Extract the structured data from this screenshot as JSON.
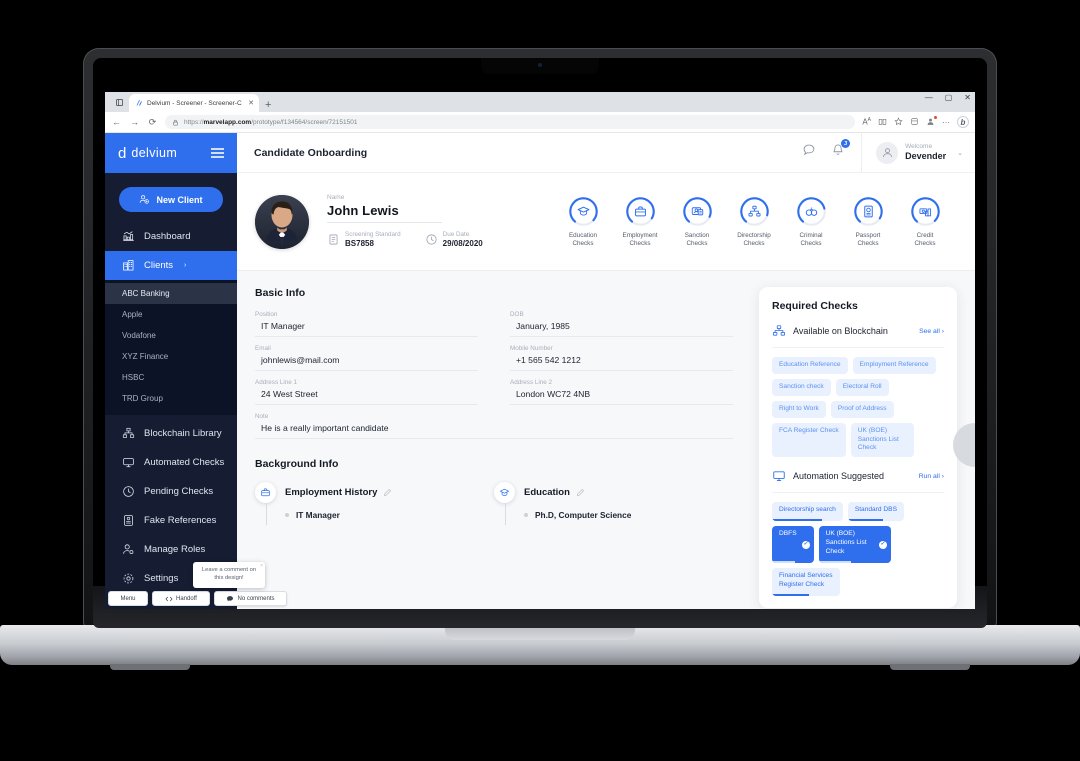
{
  "browser": {
    "tab_title": "Delvium - Screener - Screener-C",
    "tab_close": "✕",
    "new_tab": "+",
    "back": "←",
    "forward": "→",
    "reload": "⟳",
    "lock_icon": "lock-icon",
    "url_domain": "marvelapp.com",
    "url_prefix": "https://",
    "url_path": "/prototype/f134564/screen/72151501",
    "minimize": "—",
    "maximize": "▢",
    "close": "✕",
    "toolbar_icons": [
      "read-aloud-icon",
      "immersive-reader-icon",
      "favorite-icon",
      "collections-icon",
      "profile-icon",
      "more-icon"
    ],
    "bing_label": "b"
  },
  "sidebar": {
    "brand": {
      "mark": "d",
      "name": "delvium",
      "menu_icon": "hamburger-icon"
    },
    "new_client_label": "New Client",
    "items": [
      {
        "label": "Dashboard",
        "icon": "dashboard-icon",
        "active": false
      },
      {
        "label": "Clients",
        "icon": "clients-icon",
        "active": true,
        "chevron": "›"
      }
    ],
    "clients": [
      "ABC Banking",
      "Apple",
      "Vodafone",
      "XYZ Finance",
      "HSBC",
      "TRD Group"
    ],
    "selected_client": "ABC Banking",
    "group_items": [
      {
        "label": "Blockchain Library",
        "icon": "blockchain-icon"
      },
      {
        "label": "Automated Checks",
        "icon": "monitor-icon"
      },
      {
        "label": "Pending Checks",
        "icon": "clock-icon"
      },
      {
        "label": "Fake References",
        "icon": "document-icon"
      },
      {
        "label": "Manage Roles",
        "icon": "user-settings-icon"
      },
      {
        "label": "Settings",
        "icon": "settings-icon"
      }
    ]
  },
  "marvel": {
    "menu": "Menu",
    "handoff": "Handoff",
    "handoff_icon": "code-icon",
    "comments": "No comments",
    "comments_icon": "comment-icon",
    "tooltip": "Leave a comment on this design!",
    "tooltip_close": "×"
  },
  "topbar": {
    "title": "Candidate Onboarding",
    "chat_icon": "chat-icon",
    "bell_icon": "bell-icon",
    "notification_count": "3",
    "avatar_icon": "user-avatar-icon",
    "welcome_label": "Welcome",
    "user_name": "Devender",
    "caret": "⌄"
  },
  "candidate": {
    "photo_alt": "candidate-photo",
    "name_label": "Name",
    "name": "John Lewis",
    "screening_standard_label": "Screening Standard",
    "screening_standard": "BS7858",
    "screening_icon": "document-icon",
    "due_date_label": "Due Date",
    "due_date": "29/08/2020",
    "due_date_icon": "clock-icon"
  },
  "check_circles": [
    {
      "label": "Education\nChecks",
      "l1": "Education",
      "l2": "Checks",
      "icon": "graduation-cap-icon",
      "progress": 75
    },
    {
      "label": "Employment Checks",
      "l1": "Employment",
      "l2": "Checks",
      "icon": "briefcase-icon",
      "progress": 72
    },
    {
      "label": "Sanction Checks",
      "l1": "Sanction",
      "l2": "Checks",
      "icon": "sanction-icon",
      "progress": 70
    },
    {
      "label": "Directorship Checks",
      "l1": "Directorship",
      "l2": "Checks",
      "icon": "org-chart-icon",
      "progress": 68
    },
    {
      "label": "Criminal Checks",
      "l1": "Criminal",
      "l2": "Checks",
      "icon": "handcuffs-icon",
      "progress": 60
    },
    {
      "label": "Passport Checks",
      "l1": "Passport",
      "l2": "Checks",
      "icon": "passport-icon",
      "progress": 72
    },
    {
      "label": "Credit Checks",
      "l1": "Credit",
      "l2": "Checks",
      "icon": "credit-icon",
      "progress": 76
    }
  ],
  "basic_info": {
    "title": "Basic Info",
    "fields": [
      {
        "label": "Position",
        "value": "IT Manager"
      },
      {
        "label": "DOB",
        "value": "January, 1985"
      },
      {
        "label": "Email",
        "value": "johnlewis@mail.com"
      },
      {
        "label": "Mobile Number",
        "value": "+1 565 542 1212"
      },
      {
        "label": "Address Line 1",
        "value": "24 West Street"
      },
      {
        "label": "Address Line 2",
        "value": "London WC72 4NB"
      }
    ],
    "note_label": "Note",
    "note_value": "He is a really important candidate"
  },
  "background_info": {
    "title": "Background Info",
    "columns": [
      {
        "heading": "Employment History",
        "icon": "briefcase-icon",
        "edit_icon": "edit-icon",
        "items": [
          "IT Manager"
        ]
      },
      {
        "heading": "Education",
        "icon": "graduation-cap-icon",
        "edit_icon": "edit-icon",
        "items": [
          "Ph.D, Computer Science"
        ]
      }
    ]
  },
  "required_checks": {
    "title": "Required Checks",
    "blockchain": {
      "heading": "Available on Blockchain",
      "icon": "blockchain-icon",
      "link": "See all ›",
      "chips": [
        "Education Reference",
        "Employment Reference",
        "Sanction check",
        "Electoral Roll",
        "Right to Work",
        "Proof of Address",
        "FCA Register Check",
        "UK (BOE) Sanctions List Check"
      ]
    },
    "automation": {
      "heading": "Automation Suggested",
      "icon": "monitor-icon",
      "link": "Run all ›",
      "chips": [
        {
          "label": "Directorship search",
          "progress": 70,
          "solid": false,
          "done": false
        },
        {
          "label": "Standard DBS",
          "progress": 62,
          "solid": false,
          "done": false
        },
        {
          "label": "DBFS",
          "progress": 55,
          "solid": true,
          "done": true
        },
        {
          "label": "UK (BOE) Sanctions List Check",
          "progress": 45,
          "solid": true,
          "done": true
        },
        {
          "label": "Financial Services Register Check",
          "progress": 55,
          "solid": false,
          "done": false
        }
      ]
    }
  },
  "colors": {
    "brand_blue": "#2f6fed",
    "sidebar_navy": "#161d33",
    "sidebar_dark": "#0d1326",
    "chip_bg": "#e9f0fe",
    "chip_text": "#5b92f2",
    "page_bg": "#f7f8fa"
  }
}
